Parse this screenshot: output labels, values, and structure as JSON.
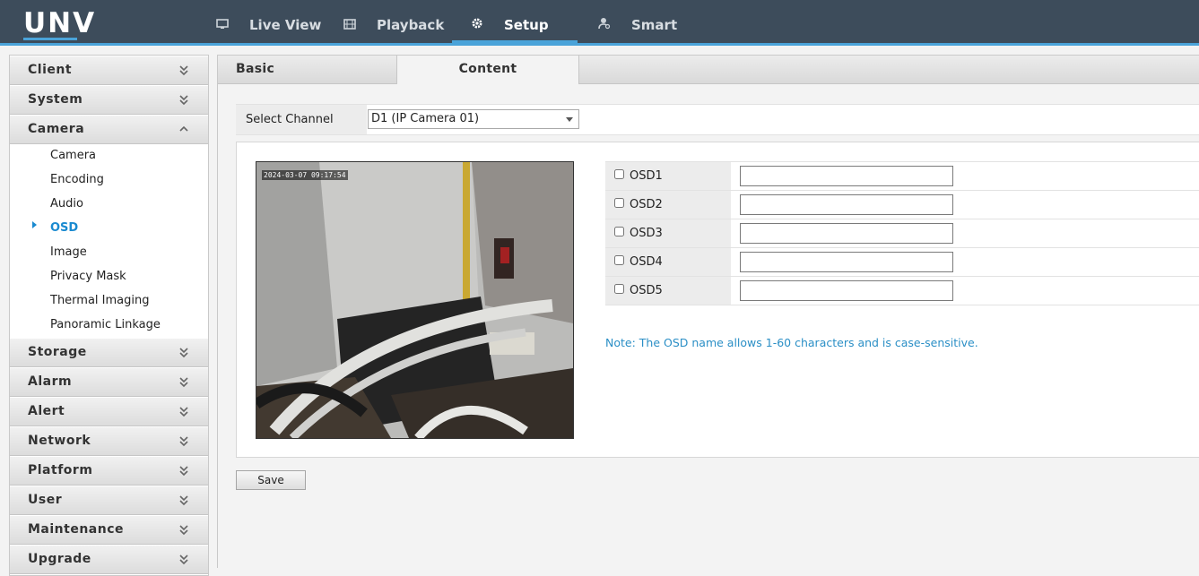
{
  "brand": {
    "logo_text": "UNV",
    "accent_color": "#4aa3d9",
    "header_color": "#3d4c5b",
    "active_color": "#1a8ad0"
  },
  "nav": {
    "items": [
      {
        "label": "Live View",
        "icon": "monitor-icon"
      },
      {
        "label": "Playback",
        "icon": "film-icon"
      },
      {
        "label": "Setup",
        "icon": "gear-icon",
        "active": true
      },
      {
        "label": "Smart",
        "icon": "person-search-icon"
      }
    ]
  },
  "sidebar": {
    "sections": [
      {
        "label": "Client",
        "expanded": false
      },
      {
        "label": "System",
        "expanded": false
      },
      {
        "label": "Camera",
        "expanded": true
      },
      {
        "label": "Storage",
        "expanded": false
      },
      {
        "label": "Alarm",
        "expanded": false
      },
      {
        "label": "Alert",
        "expanded": false
      },
      {
        "label": "Network",
        "expanded": false
      },
      {
        "label": "Platform",
        "expanded": false
      },
      {
        "label": "User",
        "expanded": false
      },
      {
        "label": "Maintenance",
        "expanded": false
      },
      {
        "label": "Upgrade",
        "expanded": false
      }
    ],
    "camera_items": [
      {
        "label": "Camera"
      },
      {
        "label": "Encoding"
      },
      {
        "label": "Audio"
      },
      {
        "label": "OSD",
        "active": true
      },
      {
        "label": "Image"
      },
      {
        "label": "Privacy Mask"
      },
      {
        "label": "Thermal Imaging"
      },
      {
        "label": "Panoramic Linkage"
      }
    ]
  },
  "tabs": [
    {
      "label": "Basic"
    },
    {
      "label": "Content",
      "active": true
    }
  ],
  "channel": {
    "label": "Select Channel",
    "selected": "D1 (IP Camera 01)"
  },
  "preview": {
    "timestamp": "2024-03-07 09:17:54"
  },
  "osd_rows": [
    {
      "label": "OSD1",
      "checked": false,
      "value": ""
    },
    {
      "label": "OSD2",
      "checked": false,
      "value": ""
    },
    {
      "label": "OSD3",
      "checked": false,
      "value": ""
    },
    {
      "label": "OSD4",
      "checked": false,
      "value": ""
    },
    {
      "label": "OSD5",
      "checked": false,
      "value": ""
    }
  ],
  "note": "Note: The OSD name allows 1-60 characters and is case-sensitive.",
  "save_label": "Save"
}
